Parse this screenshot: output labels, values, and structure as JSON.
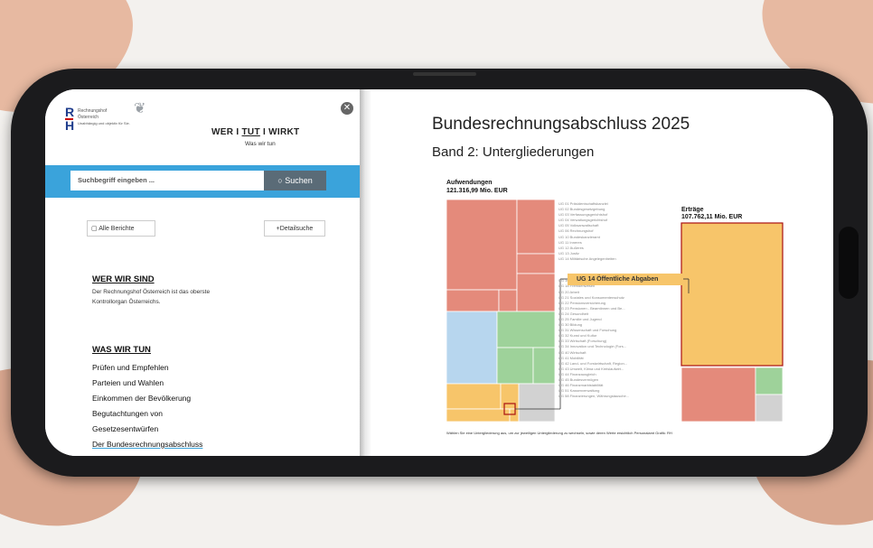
{
  "left": {
    "logo": {
      "letters_top": "R",
      "letters_bottom": "H",
      "line1": "Rechnungshof",
      "line2": "Österreich",
      "line3": "Unabhängig und objektiv für Sie."
    },
    "header_links": [
      "WER",
      "TUT",
      "WIRKT"
    ],
    "header_sep": "I",
    "header_sub": "Was wir tun",
    "search_placeholder": "Suchbegriff eingeben ...",
    "search_button": "Suchen",
    "all_reports": "Alle Berichte",
    "detail_search": "Detailsuche",
    "section1": {
      "title": "WER WIR SIND",
      "desc": "Der Rechnungshof Österreich ist das oberste Kontrollorgan Österreichs."
    },
    "section2": {
      "title": "WAS WIR TUN",
      "items": [
        "Prüfen und Empfehlen",
        "Parteien und Wahlen",
        "Einkommen der Bevölkerung",
        "Begutachtungen von",
        "Gesetzesentwürfen",
        "Der Bundesrechnungsabschluss"
      ]
    }
  },
  "right": {
    "title": "Bundesrechnungsabschluss 2025",
    "subtitle": "Band 2: Untergliederungen",
    "expenses_label": "Aufwendungen",
    "expenses_value": "121.316,99 Mio. EUR",
    "revenue_label": "Erträge",
    "revenue_value": "107.762,11 Mio. EUR",
    "highlight": "UG 14 Öffentliche Abgaben",
    "colors": {
      "red": "#e48a7b",
      "blue": "#b7d6ee",
      "green": "#9ed29a",
      "yellow": "#f7c56a",
      "gray": "#d2d2d2",
      "border": "#a11"
    },
    "ug_list": [
      "UG 01 Präsidentschaftskanzlei",
      "UG 02 Bundesgesetzgebung",
      "UG 03 Verfassungsgerichtshof",
      "UG 04 Verwaltungsgerichtshof",
      "UG 05 Volksanwaltschaft",
      "UG 06 Rechnungshof",
      "UG 10 Bundeskanzleramt",
      "UG 11 Inneres",
      "UG 12 Äußeres",
      "UG 13 Justiz",
      "UG 14 Militärische Angelegenheiten",
      "",
      "",
      "",
      "UG 16 Öffentliche Abgaben",
      "UG 18 Fremdenwesen",
      "UG 20 Arbeit",
      "UG 21 Soziales und Konsumentenschutz",
      "UG 22 Pensionsversicherung",
      "UG 23 Pensionen - Beamtinnen und Be...",
      "UG 24 Gesundheit",
      "UG 25 Familie und Jugend",
      "UG 30 Bildung",
      "UG 31 Wissenschaft und Forschung",
      "UG 32 Kunst und Kultur",
      "UG 33 Wirtschaft (Forschung)",
      "UG 34 Innovation und Technologie (Fors...",
      "UG 40 Wirtschaft",
      "UG 41 Mobilität",
      "UG 42 Land- und Forstwirtschaft, Region...",
      "UG 43 Umwelt, Klima und Kreislaufwirt...",
      "UG 44 Finanzausgleich",
      "UG 45 Bundesvermögen",
      "UG 46 Finanzmarktstabilität",
      "UG 51 Kassenverwaltung",
      "UG 58 Finanzierungen, Währungstausche..."
    ],
    "footnote": "Wählen Sie eine Untergliederung aus, um zur jeweiligen Untergliederung zu wechseln, sowie deren Werte ersichtlich Personalamt Grafik: RH"
  }
}
